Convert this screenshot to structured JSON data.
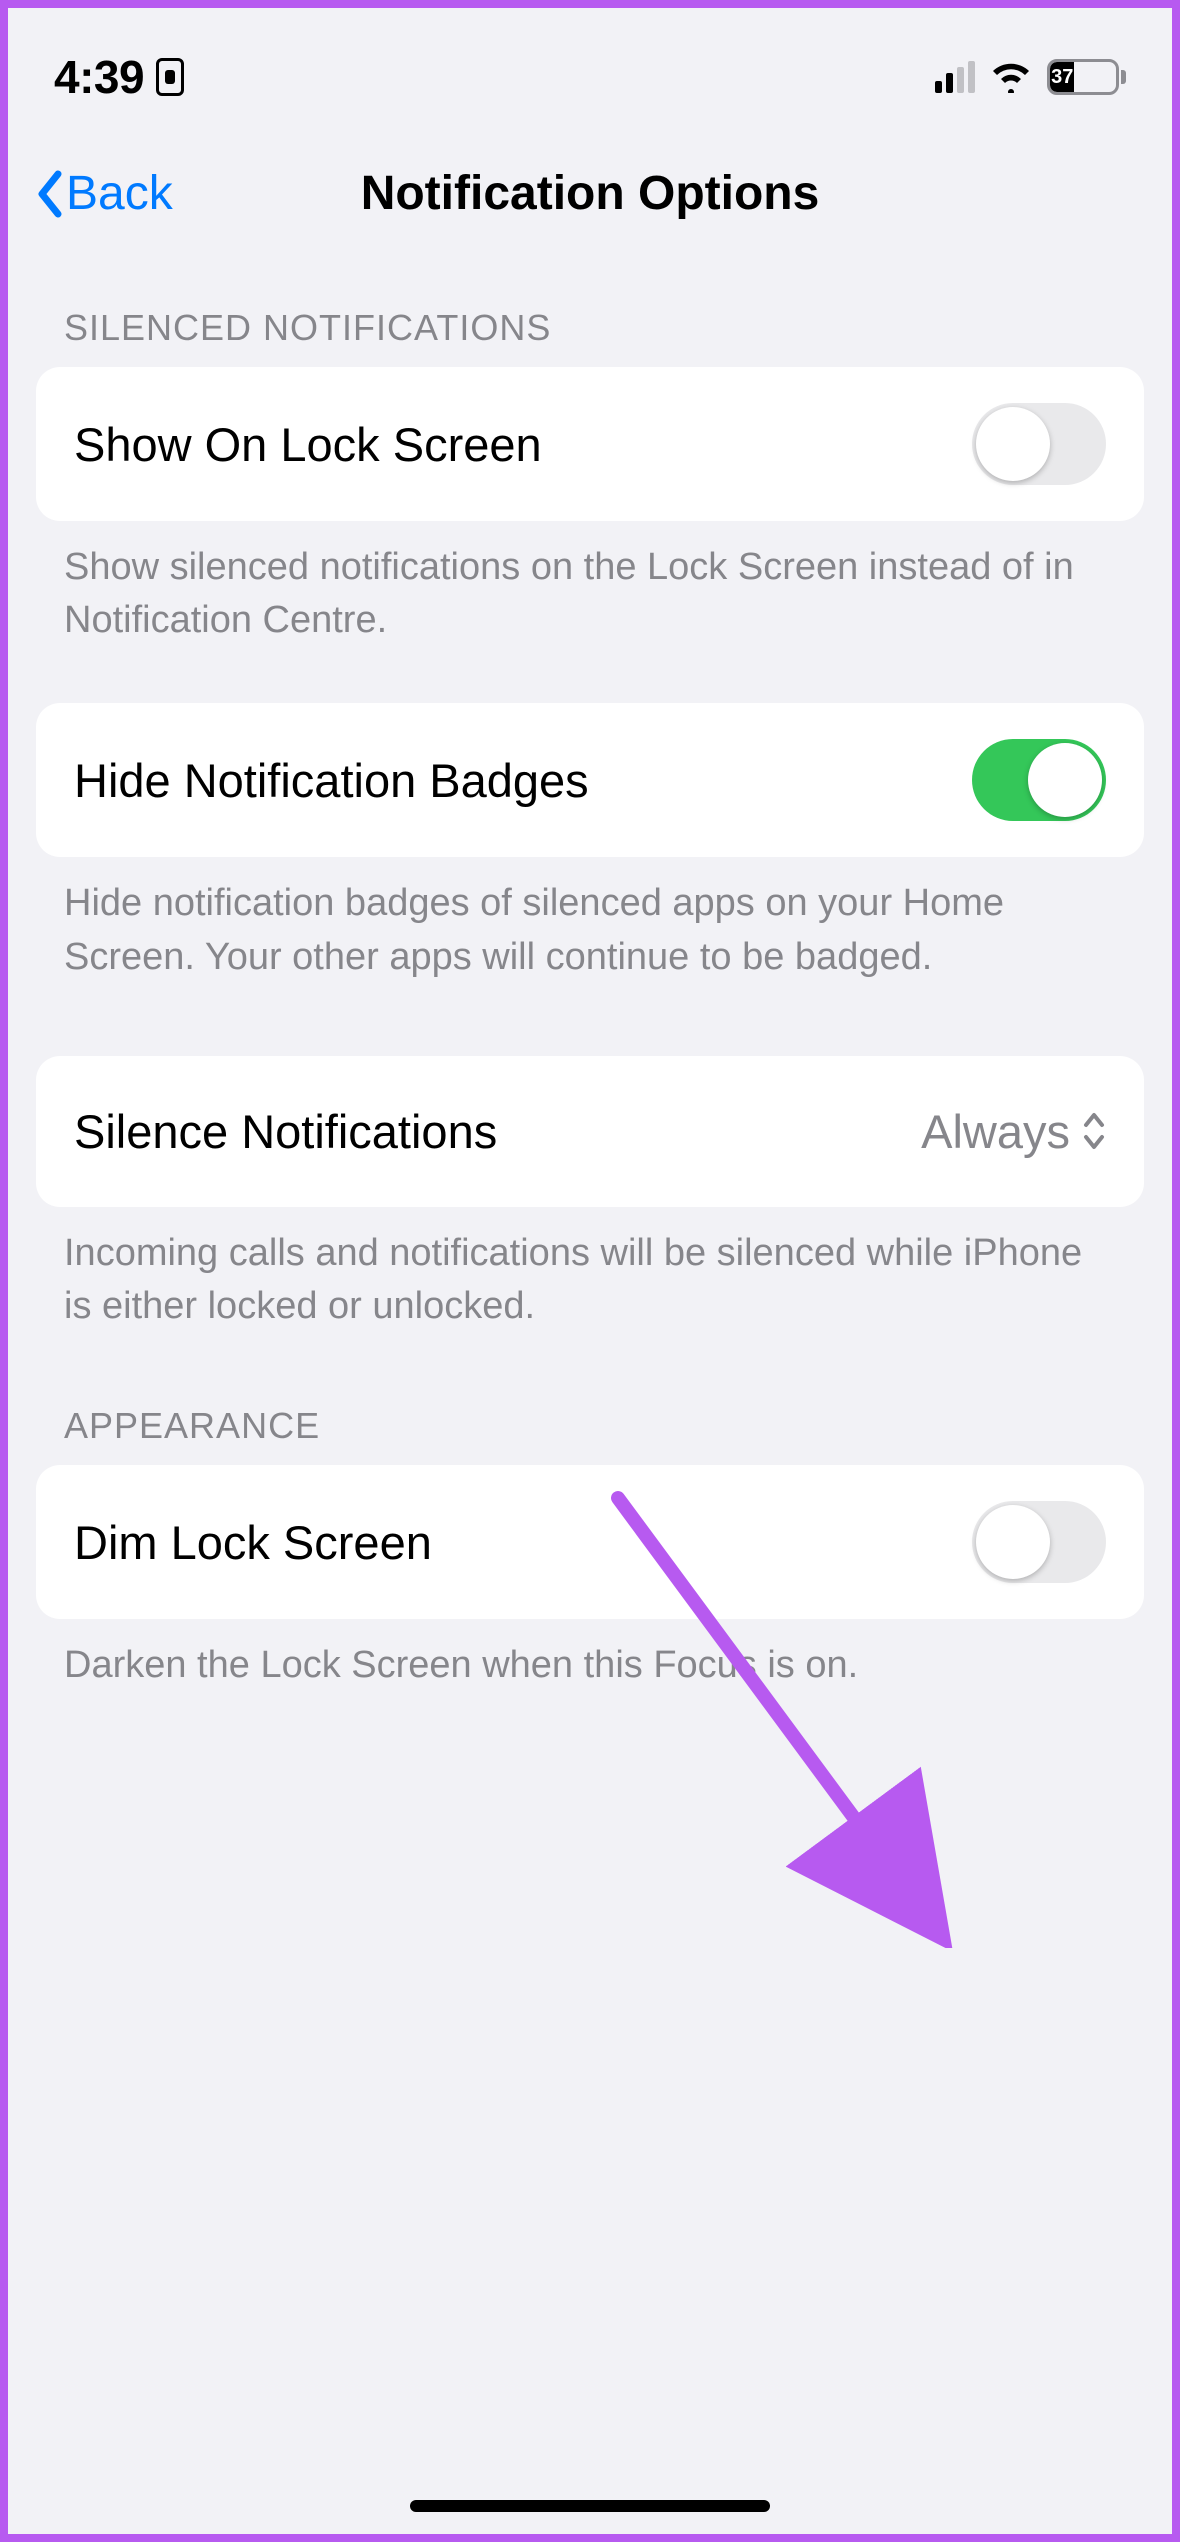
{
  "statusbar": {
    "time": "4:39",
    "battery_pct": "37"
  },
  "nav": {
    "back_label": "Back",
    "title": "Notification Options"
  },
  "sections": {
    "silenced_header": "SILENCED NOTIFICATIONS",
    "show_lock": {
      "label": "Show On Lock Screen",
      "on": false,
      "footer": "Show silenced notifications on the Lock Screen instead of in Notification Centre."
    },
    "hide_badges": {
      "label": "Hide Notification Badges",
      "on": true,
      "footer": "Hide notification badges of silenced apps on your Home Screen. Your other apps will continue to be badged."
    },
    "silence_notifications": {
      "label": "Silence Notifications",
      "value": "Always",
      "footer": "Incoming calls and notifications will be silenced while iPhone is either locked or unlocked."
    },
    "appearance_header": "APPEARANCE",
    "dim_lock": {
      "label": "Dim Lock Screen",
      "on": false,
      "footer": "Darken the Lock Screen when this Focus is on."
    }
  },
  "colors": {
    "accent": "#007aff",
    "toggle_on": "#34c759",
    "annotation": "#b75af0"
  }
}
